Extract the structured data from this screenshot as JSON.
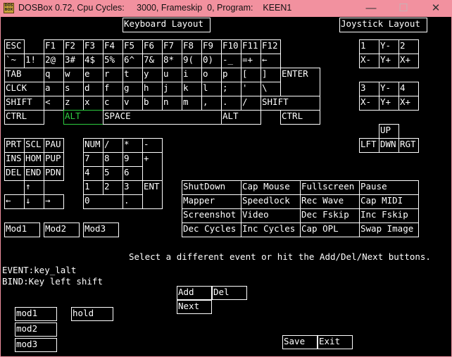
{
  "window": {
    "title": "DOSBox 0.72, Cpu Cycles:     3000, Frameskip  0, Program:    KEEN1",
    "icon_text": "DOS BOX",
    "minimize": "—",
    "maximize": "☐",
    "close": "✕"
  },
  "headers": {
    "keyboard": "Keyboard Layout",
    "joystick": "Joystick Layout"
  },
  "keyboard": {
    "rows": [
      [
        "ESC",
        "F1",
        "F2",
        "F3",
        "F4",
        "F5",
        "F6",
        "F7",
        "F8",
        "F9",
        "F10",
        "F11",
        "F12"
      ],
      [
        "`~",
        "1!",
        "2@",
        "3#",
        "4$",
        "5%",
        "6^",
        "7&",
        "8*",
        "9(",
        "0)",
        "-_",
        "=+",
        "←"
      ],
      [
        "TAB",
        "q",
        "w",
        "e",
        "r",
        "t",
        "y",
        "u",
        "i",
        "o",
        "p",
        "[",
        "]",
        "ENTER"
      ],
      [
        "CLCK",
        "a",
        "s",
        "d",
        "f",
        "g",
        "h",
        "j",
        "k",
        "l",
        ";",
        "'",
        "\\"
      ],
      [
        "SHIFT",
        "<",
        "z",
        "x",
        "c",
        "v",
        "b",
        "n",
        "m",
        ",",
        ".",
        "/",
        "SHIFT"
      ],
      [
        "CTRL",
        "ALT",
        "SPACE",
        "ALT",
        "CTRL"
      ]
    ],
    "selected": "ALT",
    "selected_color": "#2ecc40"
  },
  "nav_keys": [
    "PRT",
    "SCL",
    "PAU",
    "INS",
    "HOM",
    "PUP",
    "DEL",
    "END",
    "PDN",
    "↑",
    "←",
    "↓",
    "→"
  ],
  "numpad": [
    "NUM",
    "/",
    "*",
    "-",
    "7",
    "8",
    "9",
    "+",
    "4",
    "5",
    "6",
    "1",
    "2",
    "3",
    "ENT",
    "0",
    "."
  ],
  "joystick": {
    "pad1": [
      "1",
      "Y-",
      "2",
      "X-",
      "Y+",
      "X+"
    ],
    "pad2": [
      "3",
      "Y-",
      "4",
      "X-",
      "Y+",
      "X+"
    ],
    "arrows": [
      "UP",
      "LFT",
      "DWN",
      "RGT"
    ]
  },
  "mods": [
    "Mod1",
    "Mod2",
    "Mod3"
  ],
  "functions": [
    "ShutDown",
    "Cap Mouse",
    "Fullscreen",
    "Pause",
    "Mapper",
    "Speedlock",
    "Rec Wave",
    "Cap MIDI",
    "Screenshot",
    "Video",
    "Dec Fskip",
    "Inc Fskip",
    "Dec Cycles",
    "Inc Cycles",
    "Cap OPL",
    "Swap Image"
  ],
  "status": {
    "message": "Select a different event or hit the Add/Del/Next buttons.",
    "event": "EVENT:key_lalt",
    "bind": "BIND:Key left shift"
  },
  "bind_buttons": {
    "add": "Add",
    "del": "Del",
    "next": "Next"
  },
  "bind_mods": {
    "mod1": "mod1",
    "mod2": "mod2",
    "mod3": "mod3",
    "hold": "hold"
  },
  "footer": {
    "save": "Save",
    "exit": "Exit"
  }
}
